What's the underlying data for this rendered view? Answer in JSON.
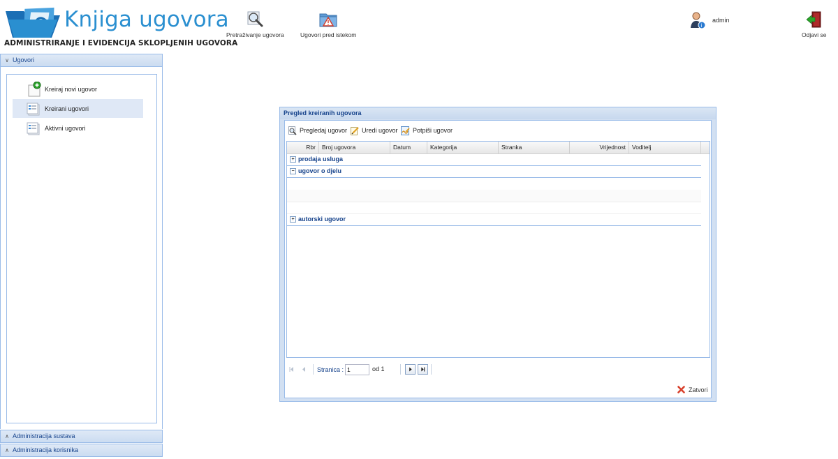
{
  "app": {
    "logo_title": "Knjiga ugovora",
    "logo_subtitle": "ADMINISTRIRANJE I EVIDENCIJA SKLOPLJENIH UGOVORA"
  },
  "toolbar": {
    "search_label": "Pretraživanje ugovora",
    "expiring_label": "Ugovori pred istekom",
    "user_name": "admin",
    "logout_label": "Odjavi se"
  },
  "sidebar": {
    "sections": [
      {
        "label": "Ugovori",
        "expanded": true
      },
      {
        "label": "Administracija sustava",
        "expanded": false
      },
      {
        "label": "Administracija korisnika",
        "expanded": false
      }
    ],
    "items": [
      {
        "label": "Kreiraj novi ugovor",
        "icon": "new-document-icon"
      },
      {
        "label": "Kreirani ugovori",
        "icon": "document-list-icon",
        "selected": true
      },
      {
        "label": "Aktivni ugovori",
        "icon": "document-list-icon"
      }
    ]
  },
  "window": {
    "title": "Pregled kreiranih ugovora",
    "actions": {
      "view": "Pregledaj ugovor",
      "edit": "Uredi ugovor",
      "sign": "Potpiši ugovor"
    },
    "columns": [
      "Rbr",
      "Broj ugovora",
      "Datum",
      "Kategorija",
      "Stranka",
      "Vrijednost",
      "Voditelj"
    ],
    "groups": [
      {
        "label": "prodaja usluga",
        "expanded": false
      },
      {
        "label": "ugovor o djelu",
        "expanded": true
      },
      {
        "label": "autorski ugovor",
        "expanded": false
      }
    ],
    "pager": {
      "page_label": "Stranica :",
      "page_value": "1",
      "of_label": "od 1"
    },
    "close_label": "Zatvori"
  },
  "colors": {
    "accent": "#2a8fd0",
    "panel_border": "#99bbe8",
    "header_text": "#15428b",
    "selection": "#dfe8f6"
  }
}
